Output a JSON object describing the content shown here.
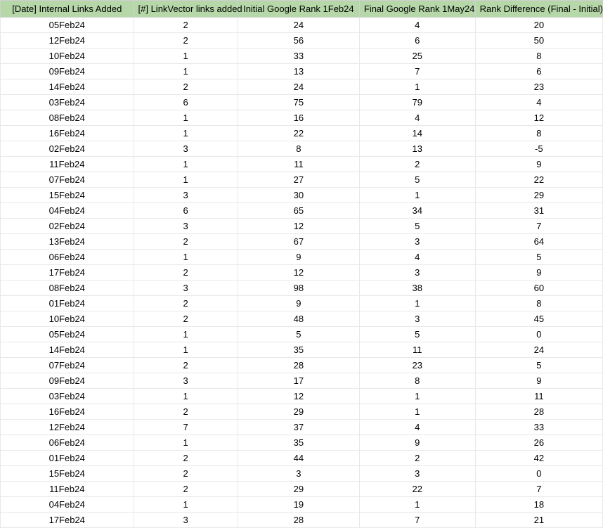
{
  "table": {
    "headers": [
      "[Date] Internal Links Added",
      "[#] LinkVector links added",
      "Initial Google Rank 1Feb24",
      "Final Google Rank 1May24",
      "Rank Difference (Final - Initial)"
    ],
    "rows": [
      [
        "05Feb24",
        "2",
        "24",
        "4",
        "20"
      ],
      [
        "12Feb24",
        "2",
        "56",
        "6",
        "50"
      ],
      [
        "10Feb24",
        "1",
        "33",
        "25",
        "8"
      ],
      [
        "09Feb24",
        "1",
        "13",
        "7",
        "6"
      ],
      [
        "14Feb24",
        "2",
        "24",
        "1",
        "23"
      ],
      [
        "03Feb24",
        "6",
        "75",
        "79",
        "4"
      ],
      [
        "08Feb24",
        "1",
        "16",
        "4",
        "12"
      ],
      [
        "16Feb24",
        "1",
        "22",
        "14",
        "8"
      ],
      [
        "02Feb24",
        "3",
        "8",
        "13",
        "-5"
      ],
      [
        "11Feb24",
        "1",
        "11",
        "2",
        "9"
      ],
      [
        "07Feb24",
        "1",
        "27",
        "5",
        "22"
      ],
      [
        "15Feb24",
        "3",
        "30",
        "1",
        "29"
      ],
      [
        "04Feb24",
        "6",
        "65",
        "34",
        "31"
      ],
      [
        "02Feb24",
        "3",
        "12",
        "5",
        "7"
      ],
      [
        "13Feb24",
        "2",
        "67",
        "3",
        "64"
      ],
      [
        "06Feb24",
        "1",
        "9",
        "4",
        "5"
      ],
      [
        "17Feb24",
        "2",
        "12",
        "3",
        "9"
      ],
      [
        "08Feb24",
        "3",
        "98",
        "38",
        "60"
      ],
      [
        "01Feb24",
        "2",
        "9",
        "1",
        "8"
      ],
      [
        "10Feb24",
        "2",
        "48",
        "3",
        "45"
      ],
      [
        "05Feb24",
        "1",
        "5",
        "5",
        "0"
      ],
      [
        "14Feb24",
        "1",
        "35",
        "11",
        "24"
      ],
      [
        "07Feb24",
        "2",
        "28",
        "23",
        "5"
      ],
      [
        "09Feb24",
        "3",
        "17",
        "8",
        "9"
      ],
      [
        "03Feb24",
        "1",
        "12",
        "1",
        "11"
      ],
      [
        "16Feb24",
        "2",
        "29",
        "1",
        "28"
      ],
      [
        "12Feb24",
        "7",
        "37",
        "4",
        "33"
      ],
      [
        "06Feb24",
        "1",
        "35",
        "9",
        "26"
      ],
      [
        "01Feb24",
        "2",
        "44",
        "2",
        "42"
      ],
      [
        "15Feb24",
        "2",
        "3",
        "3",
        "0"
      ],
      [
        "11Feb24",
        "2",
        "29",
        "22",
        "7"
      ],
      [
        "04Feb24",
        "1",
        "19",
        "1",
        "18"
      ],
      [
        "17Feb24",
        "3",
        "28",
        "7",
        "21"
      ]
    ]
  }
}
